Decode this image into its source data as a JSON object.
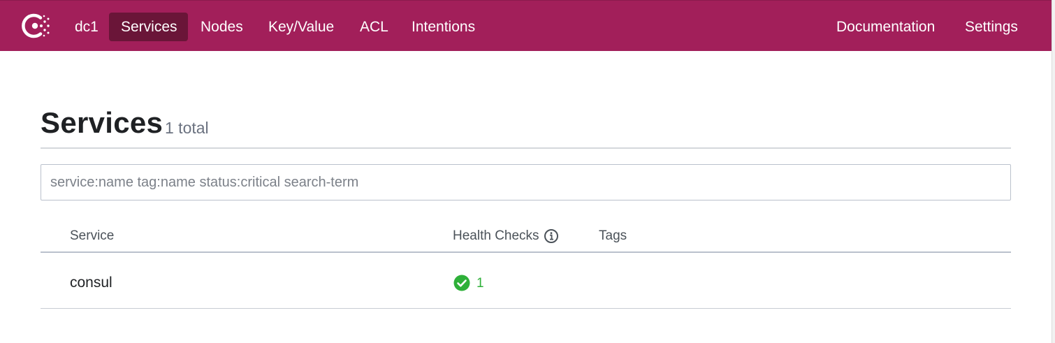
{
  "nav": {
    "datacenter": "dc1",
    "items": [
      {
        "label": "Services",
        "active": true
      },
      {
        "label": "Nodes"
      },
      {
        "label": "Key/Value"
      },
      {
        "label": "ACL"
      },
      {
        "label": "Intentions"
      }
    ],
    "right": [
      {
        "label": "Documentation"
      },
      {
        "label": "Settings"
      }
    ]
  },
  "page": {
    "title": "Services",
    "count": "1 total"
  },
  "search": {
    "placeholder": "service:name tag:name status:critical search-term"
  },
  "table": {
    "headers": [
      "Service",
      "Health Checks",
      "Tags"
    ],
    "rows": [
      {
        "service": "consul",
        "passing_checks": "1",
        "tags": ""
      }
    ]
  },
  "colors": {
    "brand": "#a21f5a",
    "active_nav": "#6a1538",
    "passing": "#2eb039"
  },
  "icons": {
    "logo": "consul-logo-icon",
    "info": "info-circle-icon",
    "passing": "check-circle-icon"
  }
}
